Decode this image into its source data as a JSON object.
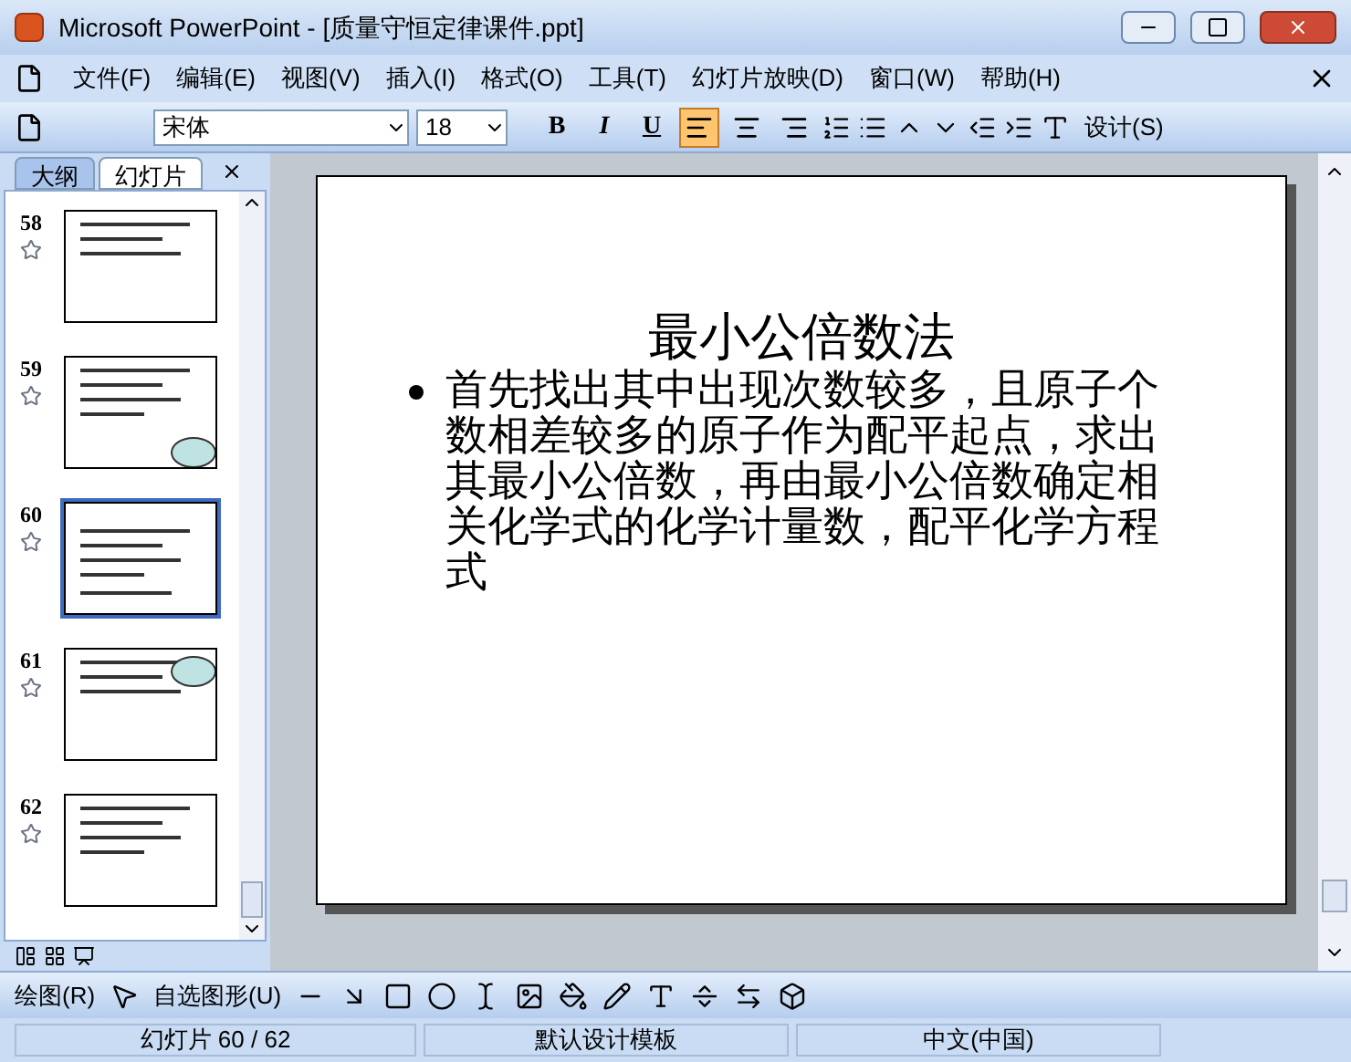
{
  "window": {
    "title": "Microsoft PowerPoint - [质量守恒定律课件.ppt]"
  },
  "menu": [
    "文件(F)",
    "编辑(E)",
    "视图(V)",
    "插入(I)",
    "格式(O)",
    "工具(T)",
    "幻灯片放映(D)",
    "窗口(W)",
    "帮助(H)"
  ],
  "toolbar": {
    "font": "宋体",
    "size": "18",
    "styles": [
      "B",
      "I",
      "U"
    ],
    "align": [
      {
        "kind": "left",
        "selected": true
      },
      {
        "kind": "center",
        "selected": false
      },
      {
        "kind": "right",
        "selected": false
      }
    ],
    "design": "设计(S)"
  },
  "tabs": [
    {
      "label": "大纲",
      "selected": false
    },
    {
      "label": "幻灯片",
      "selected": true
    }
  ],
  "slides": [
    {
      "number": "58",
      "selected": false
    },
    {
      "number": "59",
      "selected": false
    },
    {
      "number": "60",
      "selected": true
    },
    {
      "number": "61",
      "selected": false
    },
    {
      "number": "62",
      "selected": false
    }
  ],
  "slide": {
    "title": "最小公倍数法",
    "bullets": [
      "首先找出其中出现次数较多，且原子个数相差较多的原子作为配平起点，求出其最小公倍数，再由最小公倍数确定相关化学式的化学计量数，配平化学方程式"
    ]
  },
  "drawing_toolbar": {
    "draw": "绘图(R)",
    "autoshapes": "自选图形(U)"
  },
  "status_bar": [
    "幻灯片 60 / 62",
    "默认设计模板",
    "中文(中国)"
  ]
}
